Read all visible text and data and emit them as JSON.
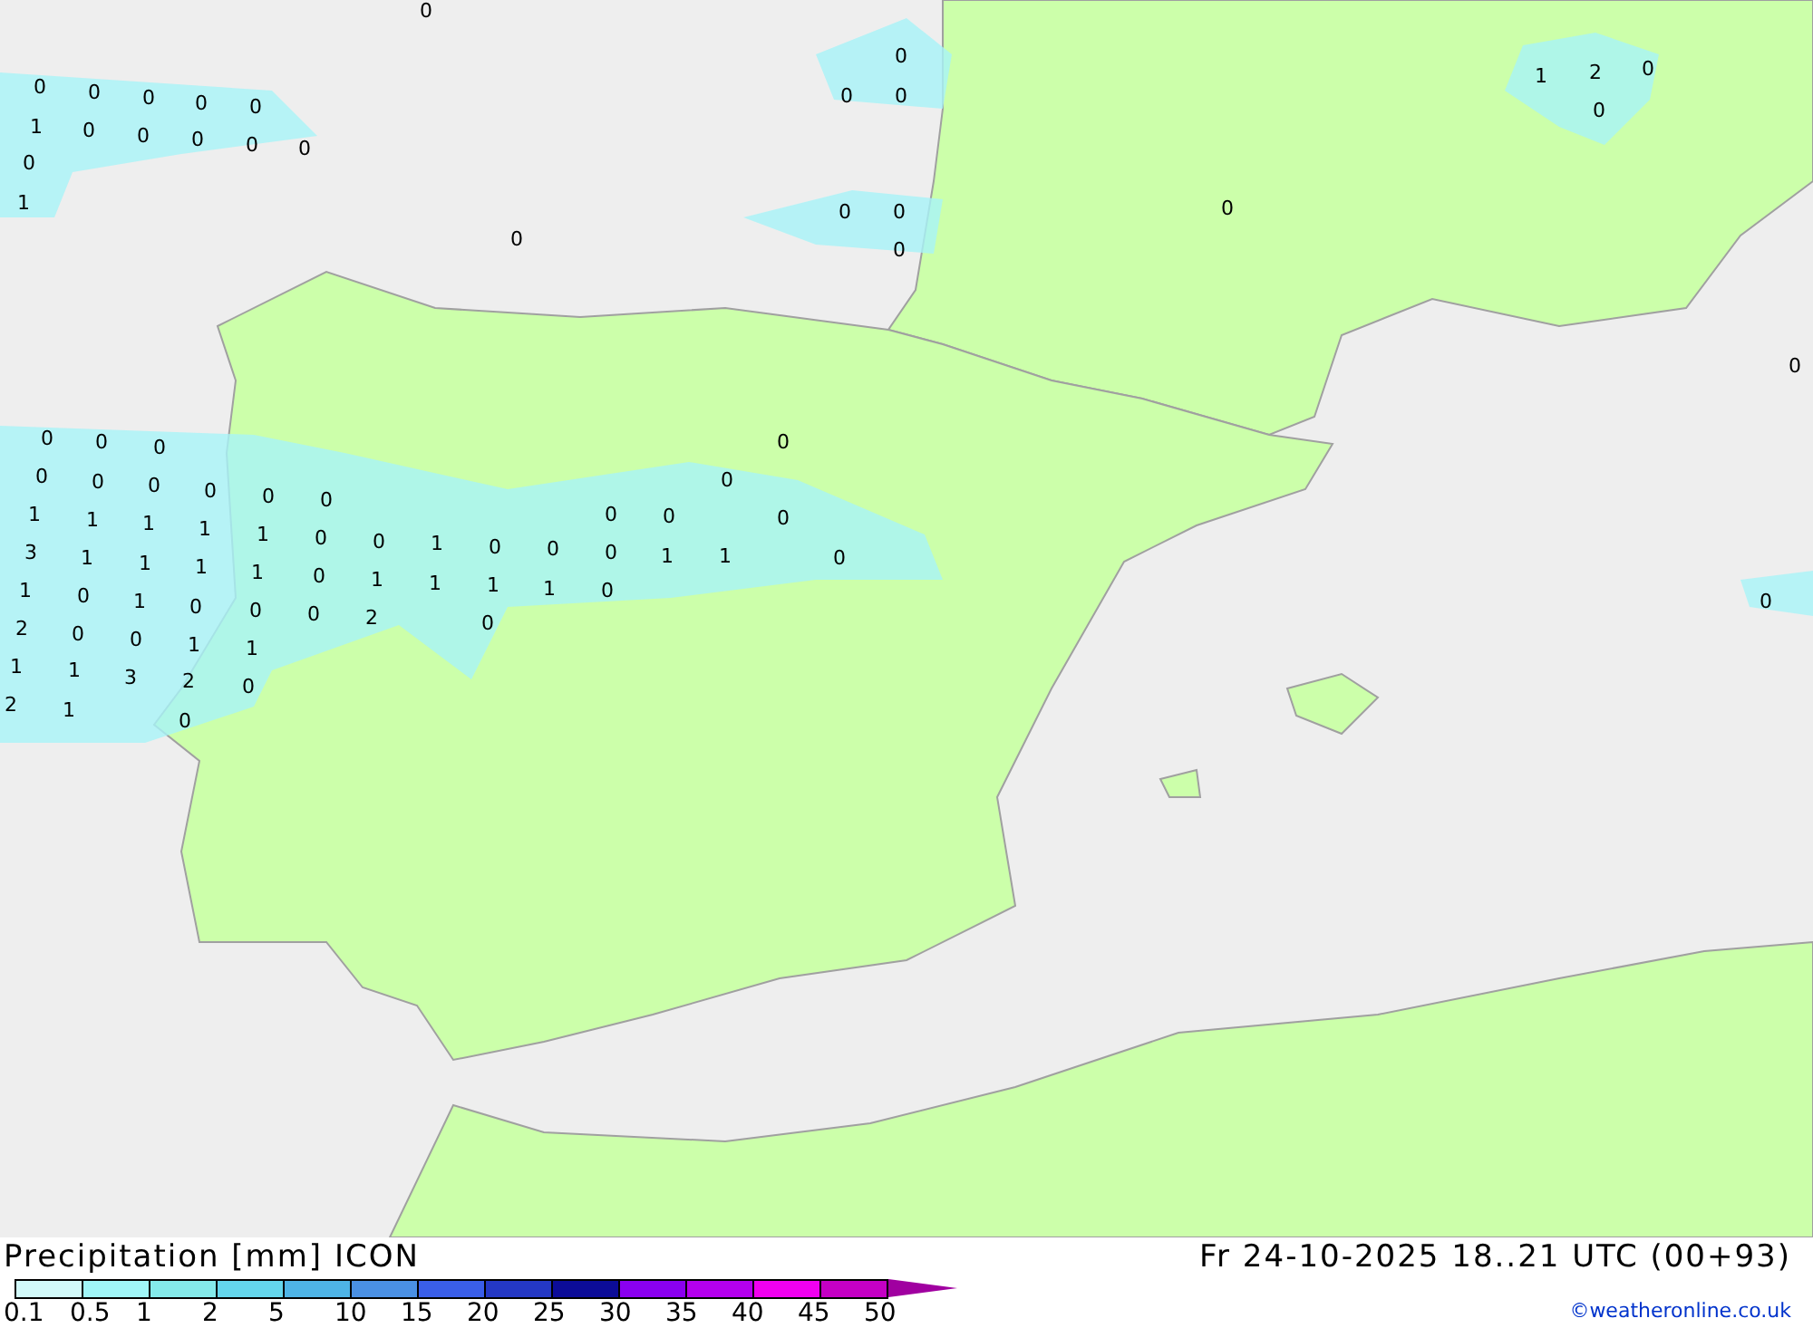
{
  "map": {
    "labels": [
      "0",
      "0",
      "0",
      "0",
      "0",
      "0",
      "1",
      "0",
      "0",
      "0",
      "0",
      "0",
      "0",
      "1",
      "0",
      "0",
      "0",
      "0",
      "0",
      "0",
      "0",
      "0",
      "1",
      "2",
      "0",
      "0",
      "0",
      "0",
      "0",
      "0",
      "0",
      "0",
      "0",
      "0",
      "0",
      "0",
      "0",
      "0",
      "0",
      "1",
      "1",
      "1",
      "1",
      "1",
      "0",
      "0",
      "1",
      "0",
      "0",
      "0",
      "0",
      "0",
      "3",
      "1",
      "1",
      "1",
      "1",
      "0",
      "1",
      "1",
      "1",
      "1",
      "0",
      "1",
      "1",
      "0",
      "1",
      "0",
      "1",
      "0",
      "0",
      "0",
      "2",
      "0",
      "0",
      "2",
      "0",
      "0",
      "1",
      "1",
      "1",
      "1",
      "3",
      "2",
      "0",
      "2",
      "1",
      "0"
    ]
  },
  "legend": {
    "title": "Precipitation [mm] ICON",
    "datetime": "Fr 24-10-2025 18..21 UTC (00+93)",
    "credit": "©weatheronline.co.uk",
    "scale": [
      {
        "color": "#d2fafa"
      },
      {
        "color": "#a0f6f8"
      },
      {
        "color": "#84eaea"
      },
      {
        "color": "#64d6ec"
      },
      {
        "color": "#4eb4e6"
      },
      {
        "color": "#4a90e4"
      },
      {
        "color": "#3a5ee8"
      },
      {
        "color": "#2438c4"
      },
      {
        "color": "#0c0c98"
      },
      {
        "color": "#8a00f0"
      },
      {
        "color": "#b400ee"
      },
      {
        "color": "#f000f0"
      },
      {
        "color": "#c400c4"
      },
      {
        "color": "#a000a0"
      }
    ],
    "ticks": [
      "0.1",
      "0.5",
      "1",
      "2",
      "5",
      "10",
      "15",
      "20",
      "25",
      "30",
      "35",
      "40",
      "45",
      "50"
    ]
  }
}
